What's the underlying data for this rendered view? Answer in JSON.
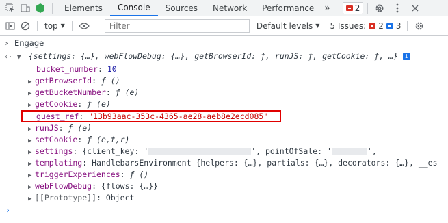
{
  "tabs": [
    {
      "label": "Elements",
      "active": false
    },
    {
      "label": "Console",
      "active": true
    },
    {
      "label": "Sources",
      "active": false
    },
    {
      "label": "Network",
      "active": false
    },
    {
      "label": "Performance",
      "active": false
    }
  ],
  "tabbar": {
    "more": "»",
    "error_count": "2"
  },
  "toolbar": {
    "context": "top",
    "filter_placeholder": "Filter",
    "levels": "Default levels",
    "issues_label": "5 Issues:",
    "issues_errors": "2",
    "issues_info": "3"
  },
  "console": {
    "cmd_prompt": "›",
    "command": "Engage",
    "result_prompt": "‹·",
    "summary": "{settings: {…}, webFlowDebug: {…}, getBrowserId: ƒ, runJS: ƒ, getCookie: ƒ, …}",
    "info_badge": "i",
    "props": [
      {
        "key": "bucket_number",
        "value": "10",
        "type": "number",
        "expandable": false
      },
      {
        "key": "getBrowserId",
        "value": "ƒ ()",
        "type": "func",
        "expandable": true
      },
      {
        "key": "getBucketNumber",
        "value": "ƒ (e)",
        "type": "func",
        "expandable": true
      },
      {
        "key": "getCookie",
        "value": "ƒ (e)",
        "type": "func",
        "expandable": true
      },
      {
        "key": "guest_ref",
        "value": "\"13b93aac-353c-4365-ae28-aeb8e2ecd085\"",
        "type": "string",
        "expandable": false
      },
      {
        "key": "runJS",
        "value": "ƒ (e)",
        "type": "func",
        "expandable": true
      },
      {
        "key": "setCookie",
        "value": "ƒ (e,t,r)",
        "type": "func",
        "expandable": true
      },
      {
        "key": "settings",
        "value": "{client_key: '",
        "tail": "', pointOfSale: '",
        "tail_end": "',",
        "type": "settings",
        "expandable": true
      },
      {
        "key": "templating",
        "value": "HandlebarsEnvironment {helpers: {…}, partials: {…}, decorators: {…}, __es",
        "type": "object",
        "expandable": true
      },
      {
        "key": "triggerExperiences",
        "value": "ƒ ()",
        "type": "func",
        "expandable": true
      },
      {
        "key": "webFlowDebug",
        "value": "{flows: {…}}",
        "type": "object",
        "expandable": true
      },
      {
        "key": "[[Prototype]]",
        "value": "Object",
        "type": "proto",
        "expandable": true
      }
    ],
    "input_prompt": "›"
  }
}
